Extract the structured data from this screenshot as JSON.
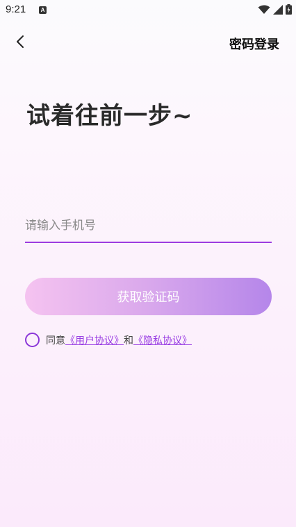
{
  "status_bar": {
    "time": "9:21",
    "notification_icon_letter": "A",
    "icons": [
      "wifi-icon",
      "signal-icon",
      "battery-icon"
    ]
  },
  "nav": {
    "back_icon": "chevron-left-icon",
    "password_login": "密码登录"
  },
  "title": "试着往前一步~",
  "phone": {
    "placeholder": "请输入手机号",
    "value": ""
  },
  "get_code_button": "获取验证码",
  "agreement": {
    "checked": false,
    "prefix": "同意",
    "user_agreement": "《用户协议》",
    "and": "和",
    "privacy_agreement": "《隐私协议》"
  },
  "colors": {
    "accent": "#9d3ce0",
    "button_gradient_start": "#f5c3f0",
    "button_gradient_end": "#b586ea",
    "link": "#9a3fe3"
  }
}
